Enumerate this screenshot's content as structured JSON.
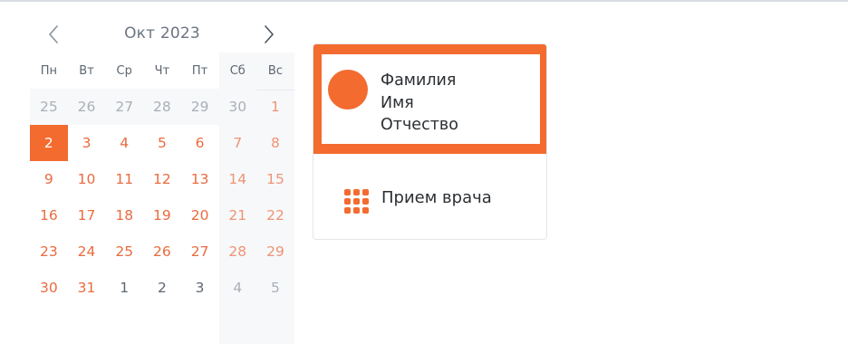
{
  "calendar": {
    "month_label": "Окт 2023",
    "weekdays": [
      "Пн",
      "Вт",
      "Ср",
      "Чт",
      "Пт",
      "Сб",
      "Вс"
    ],
    "weeks": [
      [
        "25",
        "26",
        "27",
        "28",
        "29",
        "30",
        "1"
      ],
      [
        "2",
        "3",
        "4",
        "5",
        "6",
        "7",
        "8"
      ],
      [
        "9",
        "10",
        "11",
        "12",
        "13",
        "14",
        "15"
      ],
      [
        "16",
        "17",
        "18",
        "19",
        "20",
        "21",
        "22"
      ],
      [
        "23",
        "24",
        "25",
        "26",
        "27",
        "28",
        "29"
      ],
      [
        "30",
        "31",
        "1",
        "2",
        "3",
        "4",
        "5"
      ]
    ],
    "selected_day": "2",
    "colors": {
      "accent": "#f36b2f",
      "current_month": "#ea6b3f",
      "weekend_current": "#ee9474",
      "muted": "#a9b0b7",
      "next_month": "#5f6770"
    }
  },
  "profile": {
    "last_name": "Фамилия",
    "first_name": "Имя",
    "patronymic": "Отчество"
  },
  "menu": {
    "items": [
      {
        "label": "Прием врача",
        "icon": "grid-icon"
      }
    ]
  },
  "theme": {
    "accent": "#f36b2f"
  }
}
